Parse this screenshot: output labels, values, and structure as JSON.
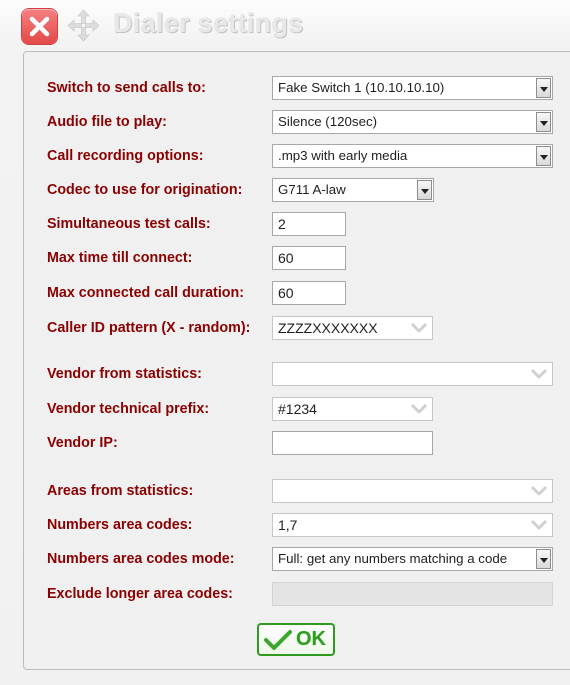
{
  "window": {
    "title": "Dialer settings",
    "icons": {
      "close": "close-icon",
      "move": "move-arrows-icon"
    }
  },
  "form": {
    "switch": {
      "label": "Switch to send calls to:",
      "value": "Fake Switch 1 (10.10.10.10)"
    },
    "audio_file": {
      "label": "Audio file to play:",
      "value": "Silence (120sec)"
    },
    "recording": {
      "label": "Call recording options:",
      "value": ".mp3 with early media"
    },
    "codec": {
      "label": "Codec to use for origination:",
      "value": "G711 A-law"
    },
    "simultaneous_calls": {
      "label": "Simultaneous test calls:",
      "value": "2"
    },
    "max_connect_time": {
      "label": "Max time till connect:",
      "value": "60"
    },
    "max_call_duration": {
      "label": "Max connected call duration:",
      "value": "60"
    },
    "caller_id_pattern": {
      "label": "Caller ID pattern (X - random):",
      "value": "ZZZZXXXXXXX"
    },
    "vendor_from_stats": {
      "label": "Vendor from statistics:",
      "value": ""
    },
    "vendor_prefix": {
      "label": "Vendor technical prefix:",
      "value": "#1234"
    },
    "vendor_ip": {
      "label": "Vendor IP:",
      "value": ""
    },
    "areas_from_stats": {
      "label": "Areas from statistics:",
      "value": ""
    },
    "area_codes": {
      "label": "Numbers area codes:",
      "value": "1,7"
    },
    "area_codes_mode": {
      "label": "Numbers area codes mode:",
      "value": "Full: get any numbers matching a code"
    },
    "exclude_longer": {
      "label": "Exclude longer area codes:",
      "value": ""
    }
  },
  "ok_button": {
    "label": "OK",
    "icon": "checkmark-icon"
  },
  "colors": {
    "label": "#8b0000",
    "ok_green": "#2e9a1f",
    "close_red": "#e34848"
  }
}
